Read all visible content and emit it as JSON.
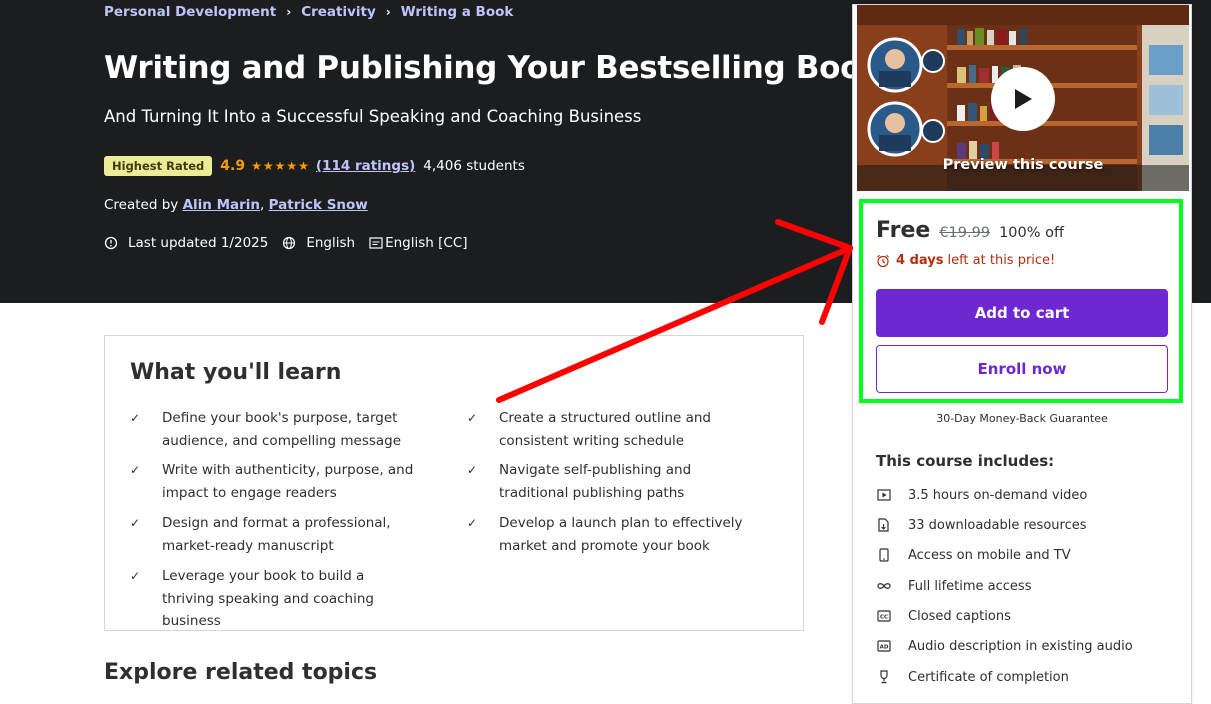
{
  "breadcrumb": [
    "Personal Development",
    "Creativity",
    "Writing a Book"
  ],
  "course": {
    "title": "Writing and Publishing Your Bestselling Book",
    "subtitle": "And Turning It Into a Successful Speaking and Coaching Business",
    "badge": "Highest Rated",
    "rating": "4.9",
    "stars": "★★★★★",
    "ratings_count": "(114 ratings)",
    "students": "4,406 students",
    "created_by_label": "Created by",
    "authors": [
      "Alin Marin",
      "Patrick Snow"
    ],
    "last_updated": "Last updated 1/2025",
    "language": "English",
    "captions": "English [CC]"
  },
  "learn": {
    "title": "What you'll learn",
    "items": [
      "Define your book's purpose, target audience, and compelling message",
      "Create a structured outline and consistent writing schedule",
      "Write with authenticity, purpose, and impact to engage readers",
      "Navigate self-publishing and traditional publishing paths",
      "Design and format a professional, market-ready manuscript",
      "Develop a launch plan to effectively market and promote your book",
      "Leverage your book to build a thriving speaking and coaching business"
    ]
  },
  "explore_title": "Explore related topics",
  "card": {
    "preview_label": "Preview this course",
    "price": "Free",
    "original_price": "€19.99",
    "discount": "100% off",
    "timer_days": "4 days",
    "timer_rest": "left at this price!",
    "add_to_cart": "Add to cart",
    "enroll_now": "Enroll now",
    "guarantee": "30-Day Money-Back Guarantee",
    "includes_title": "This course includes:",
    "includes": [
      {
        "icon": "video-icon",
        "text": "3.5 hours on-demand video"
      },
      {
        "icon": "file-download-icon",
        "text": "33 downloadable resources"
      },
      {
        "icon": "mobile-icon",
        "text": "Access on mobile and TV"
      },
      {
        "icon": "infinity-icon",
        "text": "Full lifetime access"
      },
      {
        "icon": "cc-icon",
        "text": "Closed captions"
      },
      {
        "icon": "audio-description-icon",
        "text": "Audio description in existing audio"
      },
      {
        "icon": "trophy-icon",
        "text": "Certificate of completion"
      }
    ]
  },
  "colors": {
    "hero_bg": "#1c1d1f",
    "link": "#c0c4fc",
    "accent": "#6d28d2",
    "star": "#f69c08",
    "highlight": "#00ff1e",
    "annotation_arrow": "#ff0000"
  }
}
